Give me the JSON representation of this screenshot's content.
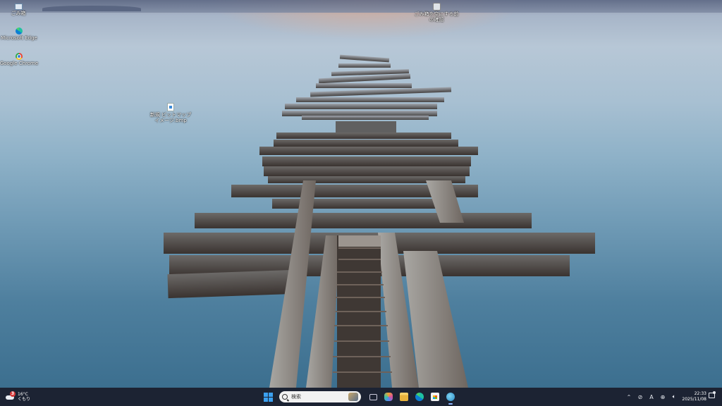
{
  "desktop": {
    "icons": [
      {
        "label": "ごみ箱",
        "icon": "recycle-bin-icon"
      },
      {
        "label": "Microsoft Edge",
        "icon": "edge-icon"
      },
      {
        "label": "Google Chrome",
        "icon": "chrome-icon"
      },
      {
        "label": "新規 ビットマップ イメージ.bmp",
        "icon": "bitmap-file-icon"
      },
      {
        "label": "ごみ箱を空にする前の確認",
        "icon": "shortcut-icon"
      }
    ]
  },
  "taskbar": {
    "weather": {
      "temp": "16°C",
      "condition": "くもり",
      "badge": "3"
    },
    "search": {
      "placeholder": "検索"
    },
    "apps": [
      {
        "name": "Task View",
        "icon": "task-view-icon"
      },
      {
        "name": "Copilot",
        "icon": "copilot-icon"
      },
      {
        "name": "File Explorer",
        "icon": "folder-icon"
      },
      {
        "name": "Microsoft Edge",
        "icon": "edge-icon"
      },
      {
        "name": "Microsoft Store",
        "icon": "store-icon"
      },
      {
        "name": "Browser",
        "icon": "globe-icon"
      }
    ],
    "tray": {
      "ime": "A",
      "time": "22:33",
      "date": "2025/11/08"
    }
  },
  "colors": {
    "taskbar": "#1c2333",
    "accent": "#3ba0f0"
  }
}
